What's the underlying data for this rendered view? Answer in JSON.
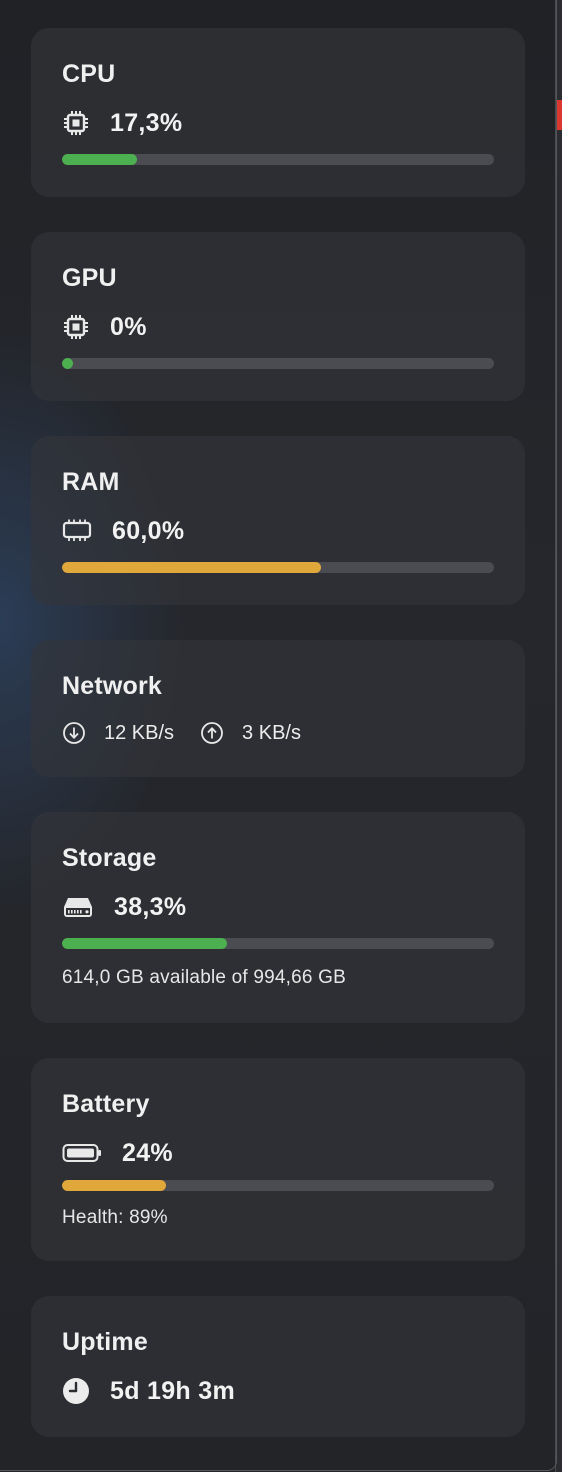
{
  "colors": {
    "ok": "#4caf50",
    "warn": "#e0a73a",
    "track": "#4b4c51"
  },
  "cpu": {
    "title": "CPU",
    "icon": "chip-icon",
    "value": "17,3%",
    "percent": 17.3,
    "status": "ok"
  },
  "gpu": {
    "title": "GPU",
    "icon": "chip-icon",
    "value": "0%",
    "percent": 0,
    "status": "ok"
  },
  "ram": {
    "title": "RAM",
    "icon": "memory-module-icon",
    "value": "60,0%",
    "percent": 60.0,
    "status": "warn"
  },
  "network": {
    "title": "Network",
    "download_icon": "arrow-down-circle-icon",
    "download": "12 KB/s",
    "upload_icon": "arrow-up-circle-icon",
    "upload": "3 KB/s"
  },
  "storage": {
    "title": "Storage",
    "icon": "hard-drive-icon",
    "value": "38,3%",
    "percent": 38.3,
    "status": "ok",
    "detail": "614,0 GB available of 994,66 GB"
  },
  "battery": {
    "title": "Battery",
    "icon": "battery-icon",
    "value": "24%",
    "percent": 24,
    "status": "warn",
    "detail": "Health: 89%"
  },
  "uptime": {
    "title": "Uptime",
    "icon": "clock-icon",
    "value": "5d 19h 3m"
  }
}
